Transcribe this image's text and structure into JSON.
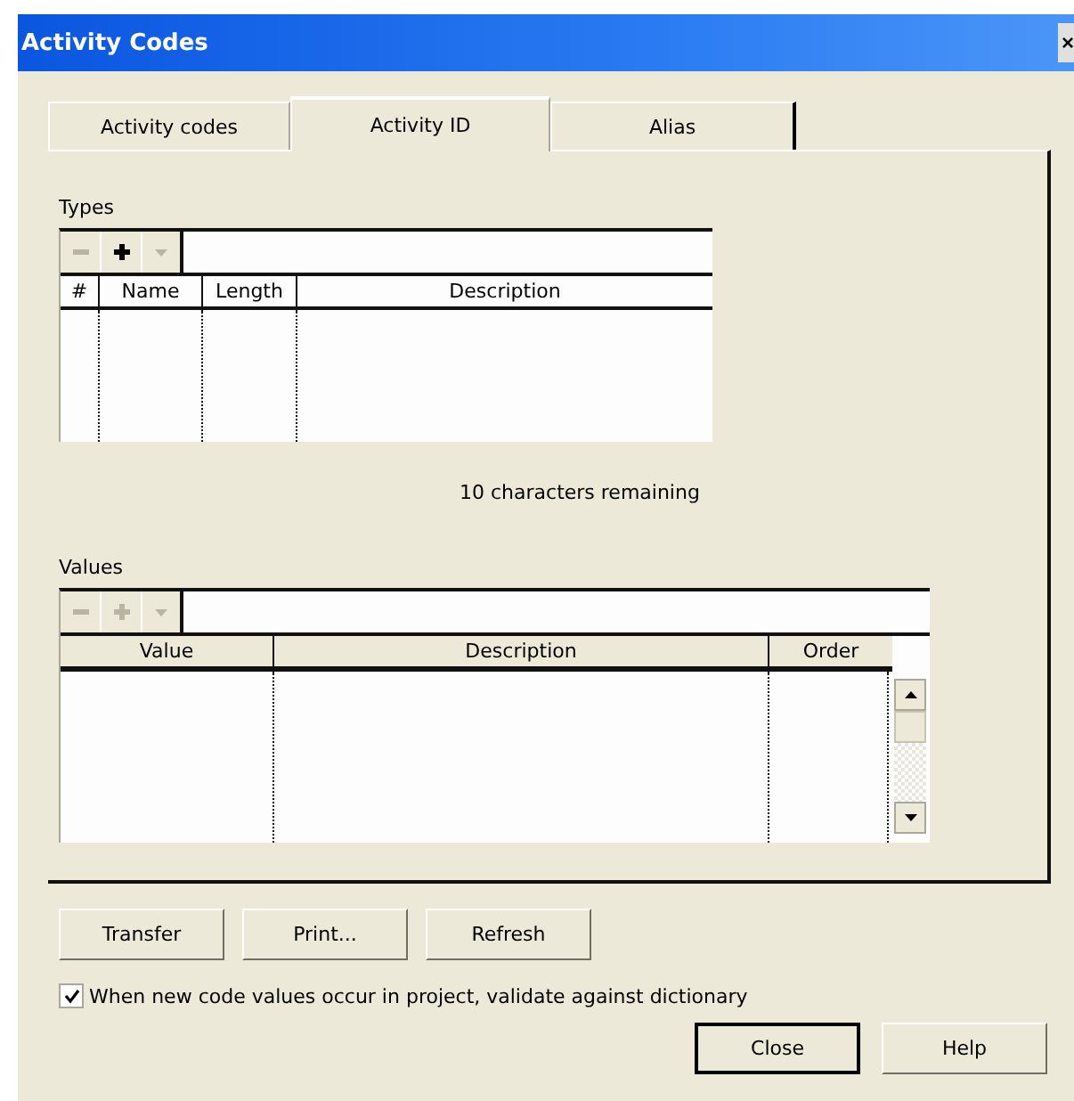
{
  "window": {
    "title": "Activity Codes",
    "close": "×"
  },
  "tabs": [
    {
      "label": "Activity codes",
      "selected": false
    },
    {
      "label": "Activity ID",
      "selected": true
    },
    {
      "label": "Alias",
      "selected": false
    }
  ],
  "types": {
    "label": "Types",
    "toolbar": [
      {
        "kind": "remove",
        "disabled": true
      },
      {
        "kind": "add",
        "disabled": false
      },
      {
        "kind": "menu",
        "disabled": true
      }
    ],
    "columns": [
      "#",
      "Name",
      "Length",
      "Description"
    ]
  },
  "remaining": "10 characters remaining",
  "values": {
    "label": "Values",
    "toolbar": [
      {
        "kind": "remove",
        "disabled": true
      },
      {
        "kind": "add",
        "disabled": true
      },
      {
        "kind": "menu",
        "disabled": true
      }
    ],
    "columns": [
      "Value",
      "Description",
      "Order"
    ]
  },
  "buttons": [
    "Transfer",
    "Print...",
    "Refresh"
  ],
  "validate": {
    "label": "When new code values occur in project, validate against dictionary",
    "checked": true
  },
  "footer_buttons": [
    "Close",
    "Help"
  ]
}
